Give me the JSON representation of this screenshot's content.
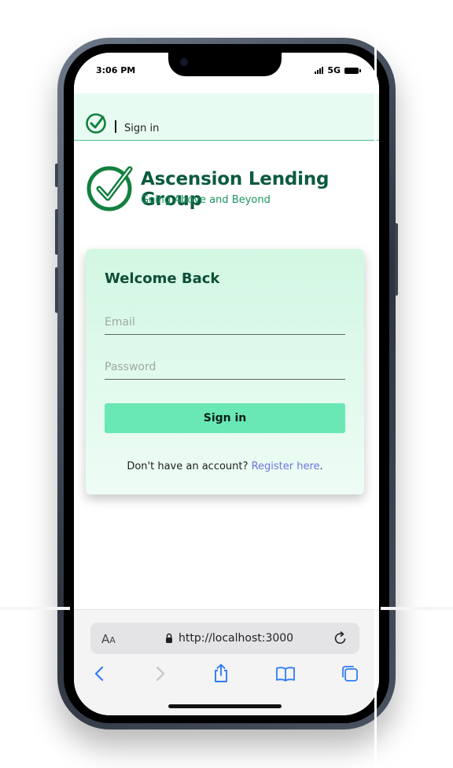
{
  "status_bar": {
    "time": "3:06 PM",
    "network": "5G"
  },
  "header": {
    "title": "Sign in"
  },
  "brand": {
    "name": "Ascension Lending Group",
    "tagline": "Going Above and Beyond",
    "color": "#0d5b3f",
    "accent": "#1c9462"
  },
  "login_card": {
    "title": "Welcome Back",
    "email_placeholder": "Email",
    "password_placeholder": "Password",
    "submit_label": "Sign in",
    "register_prompt": "Don't have an account?",
    "register_link": "Register here",
    "register_suffix": ".",
    "button_color": "#69e8b6"
  },
  "browser": {
    "text_size_label": "A",
    "text_size_small": "A",
    "url": "http://localhost:3000",
    "toolbar_icons": [
      "back-icon",
      "forward-icon",
      "share-icon",
      "bookmarks-icon",
      "tabs-icon"
    ]
  }
}
